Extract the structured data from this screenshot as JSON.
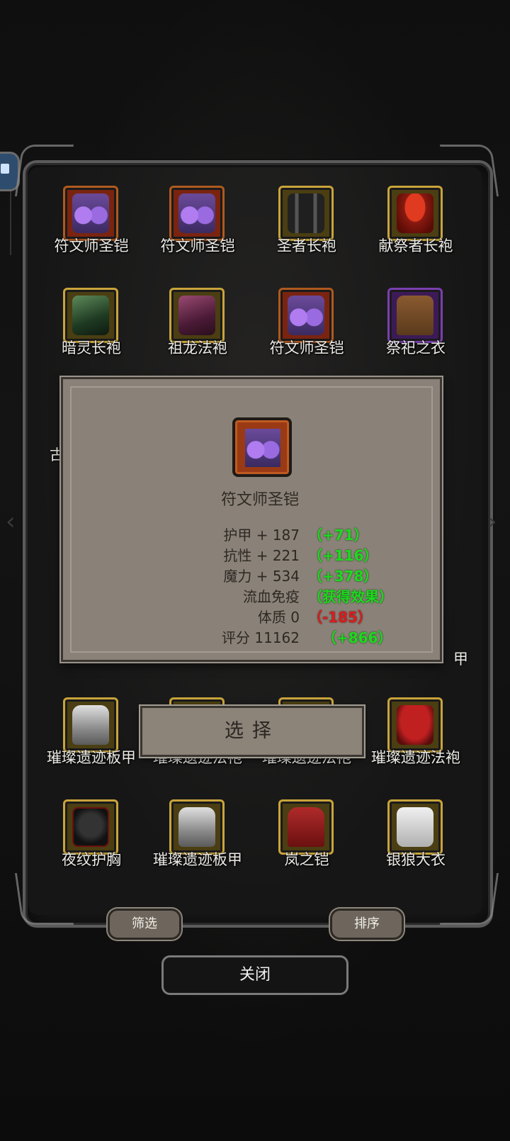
{
  "inventory": {
    "items": [
      {
        "name": "符文师圣铠",
        "rarity": "red",
        "icon": "purple-armor-icon"
      },
      {
        "name": "符文师圣铠",
        "rarity": "red",
        "icon": "purple-armor-icon"
      },
      {
        "name": "圣者长袍",
        "rarity": "gold",
        "icon": "dark-robe-icon"
      },
      {
        "name": "献祭者长袍",
        "rarity": "gold",
        "icon": "red-robe-icon"
      },
      {
        "name": "暗灵长袍",
        "rarity": "gold",
        "icon": "green-robe-icon"
      },
      {
        "name": "祖龙法袍",
        "rarity": "gold",
        "icon": "pink-robe-icon"
      },
      {
        "name": "符文师圣铠",
        "rarity": "red",
        "icon": "purple-armor-icon"
      },
      {
        "name": "祭祀之衣",
        "rarity": "purple",
        "icon": "brown-tunic-icon"
      },
      {
        "name": "璀璨遗迹板甲",
        "rarity": "gold",
        "icon": "plate-armor-icon"
      },
      {
        "name": "璀璨遗迹法袍",
        "rarity": "gold",
        "icon": "robe-icon"
      },
      {
        "name": "璀璨遗迹法袍",
        "rarity": "gold",
        "icon": "robe-icon"
      },
      {
        "name": "璀璨遗迹法袍",
        "rarity": "gold",
        "icon": "red-hood-icon"
      },
      {
        "name": "夜纹护胸",
        "rarity": "gold",
        "icon": "night-chest-icon"
      },
      {
        "name": "璀璨遗迹板甲",
        "rarity": "gold",
        "icon": "plate-armor-icon"
      },
      {
        "name": "岚之铠",
        "rarity": "gold",
        "icon": "red-armor-icon"
      },
      {
        "name": "银狼大衣",
        "rarity": "gold",
        "icon": "silver-coat-icon"
      }
    ],
    "peek_left": "古",
    "peek_right": "甲"
  },
  "detail": {
    "name": "符文师圣铠",
    "icon": "purple-armor-icon",
    "stats": [
      {
        "label": "护甲 + 187",
        "delta": "（+71）",
        "tone": "green"
      },
      {
        "label": "抗性 + 221",
        "delta": "（+116）",
        "tone": "green"
      },
      {
        "label": "魔力 + 534",
        "delta": "（+378）",
        "tone": "green"
      },
      {
        "label": "流血免疫",
        "delta": "（获得效果）",
        "tone": "green"
      },
      {
        "label": "体质  0",
        "delta": "（-185）",
        "tone": "red"
      },
      {
        "label": "评分 11162",
        "delta": "（+866）",
        "tone": "green"
      }
    ],
    "select_label": "选择"
  },
  "buttons": {
    "filter": "筛选",
    "sort": "排序",
    "close": "关闭"
  },
  "colors": {
    "rarity_red": "#b0591e",
    "rarity_gold": "#c9a43a",
    "rarity_purple": "#7a3fb0",
    "delta_green": "#1fd91f",
    "delta_red": "#d81e1e"
  }
}
